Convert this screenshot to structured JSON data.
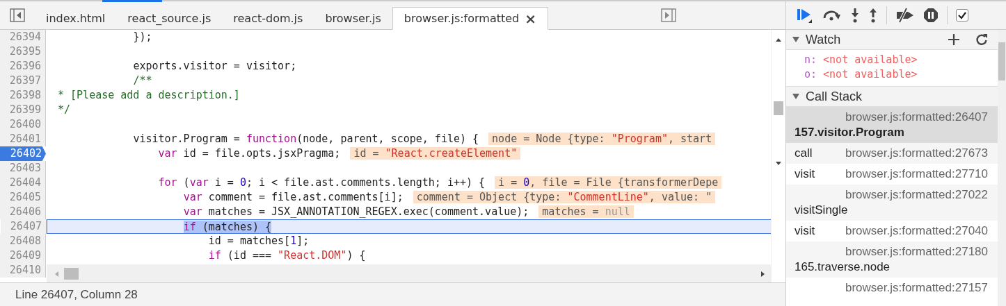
{
  "editor_tabs": [
    {
      "label": "index.html",
      "selected": false,
      "closable": false
    },
    {
      "label": "react_source.js",
      "selected": false,
      "closable": false
    },
    {
      "label": "react-dom.js",
      "selected": false,
      "closable": false
    },
    {
      "label": "browser.js",
      "selected": false,
      "closable": false
    },
    {
      "label": "browser.js:formatted",
      "selected": true,
      "closable": true,
      "close_glyph": "×"
    }
  ],
  "code_lines": [
    {
      "number": "26394",
      "breakpoint": false,
      "current": false,
      "tokens": [
        {
          "kind": "plain",
          "text": "            });"
        }
      ]
    },
    {
      "number": "26395",
      "breakpoint": false,
      "current": false
    },
    {
      "number": "26396",
      "breakpoint": false,
      "current": false,
      "tokens": [
        {
          "kind": "plain",
          "text": "            exports.visitor = visitor;"
        }
      ]
    },
    {
      "number": "26397",
      "breakpoint": false,
      "current": false,
      "tokens": [
        {
          "kind": "comment",
          "text": "            /**"
        }
      ]
    },
    {
      "number": "26398",
      "breakpoint": false,
      "current": false,
      "tokens": [
        {
          "kind": "comment",
          "text": "* [Please add a description.]"
        }
      ]
    },
    {
      "number": "26399",
      "breakpoint": false,
      "current": false,
      "tokens": [
        {
          "kind": "comment",
          "text": "*/"
        }
      ]
    },
    {
      "number": "26400",
      "breakpoint": false,
      "current": false
    },
    {
      "number": "26401",
      "breakpoint": false,
      "current": false,
      "tokens": [
        {
          "kind": "plain",
          "text": "            visitor.Program = "
        },
        {
          "kind": "keyword",
          "text": "function"
        },
        {
          "kind": "plain",
          "text": "(node, parent, scope, file) {"
        }
      ],
      "inline_value": [
        {
          "kind": "plain",
          "text": "node = Node {type: "
        },
        {
          "kind": "string",
          "text": "\"Program\""
        },
        {
          "kind": "plain",
          "text": ", start"
        }
      ]
    },
    {
      "number": "26402",
      "breakpoint": true,
      "current": false,
      "tokens": [
        {
          "kind": "keyword",
          "text": "                var"
        },
        {
          "kind": "plain",
          "text": " id = file.opts.jsxPragma;"
        }
      ],
      "inline_value": [
        {
          "kind": "plain",
          "text": "id = "
        },
        {
          "kind": "string",
          "text": "\"React.createElement\""
        }
      ]
    },
    {
      "number": "26403",
      "breakpoint": false,
      "current": false
    },
    {
      "number": "26404",
      "breakpoint": false,
      "current": false,
      "tokens": [
        {
          "kind": "keyword",
          "text": "                for"
        },
        {
          "kind": "plain",
          "text": " ("
        },
        {
          "kind": "keyword",
          "text": "var"
        },
        {
          "kind": "plain",
          "text": " i = "
        },
        {
          "kind": "number",
          "text": "0"
        },
        {
          "kind": "plain",
          "text": "; i < file.ast.comments.length; i++) {"
        }
      ],
      "inline_value": [
        {
          "kind": "plain",
          "text": "i = "
        },
        {
          "kind": "number",
          "text": "0"
        },
        {
          "kind": "plain",
          "text": ", file = File {transformerDepe"
        }
      ]
    },
    {
      "number": "26405",
      "breakpoint": false,
      "current": false,
      "tokens": [
        {
          "kind": "keyword",
          "text": "                    var"
        },
        {
          "kind": "plain",
          "text": " comment = file.ast.comments[i];"
        }
      ],
      "inline_value": [
        {
          "kind": "plain",
          "text": "comment = Object {type: "
        },
        {
          "kind": "string",
          "text": "\"CommentLine\""
        },
        {
          "kind": "plain",
          "text": ", value: \""
        }
      ]
    },
    {
      "number": "26406",
      "breakpoint": false,
      "current": false,
      "tokens": [
        {
          "kind": "keyword",
          "text": "                    var"
        },
        {
          "kind": "plain",
          "text": " matches = JSX_ANNOTATION_REGEX.exec(comment.value);"
        }
      ],
      "inline_value": [
        {
          "kind": "plain",
          "text": "matches = "
        },
        {
          "kind": "null",
          "text": "null"
        }
      ]
    },
    {
      "number": "26407",
      "breakpoint": false,
      "current": true,
      "tokens": [
        {
          "kind": "keyword",
          "text": "                    if"
        },
        {
          "kind": "plain",
          "text": " (matches) {"
        }
      ]
    },
    {
      "number": "26408",
      "breakpoint": false,
      "current": false,
      "tokens": [
        {
          "kind": "plain",
          "text": "                        id = matches["
        },
        {
          "kind": "number",
          "text": "1"
        },
        {
          "kind": "plain",
          "text": "];"
        }
      ]
    },
    {
      "number": "26409",
      "breakpoint": false,
      "current": false,
      "tokens": [
        {
          "kind": "keyword",
          "text": "                        if"
        },
        {
          "kind": "plain",
          "text": " (id === "
        },
        {
          "kind": "string",
          "text": "\"React.DOM\""
        },
        {
          "kind": "plain",
          "text": ") {"
        }
      ]
    },
    {
      "number": "26410",
      "breakpoint": false,
      "current": false
    }
  ],
  "status_bar": {
    "text": "Line 26407, Column 28"
  },
  "debugger_toolbar": [
    {
      "kind": "resume"
    },
    {
      "kind": "step-over"
    },
    {
      "kind": "step-into"
    },
    {
      "kind": "step-out"
    },
    {
      "kind": "divider"
    },
    {
      "kind": "deactivate"
    },
    {
      "kind": "pause-exceptions"
    },
    {
      "kind": "divider"
    },
    {
      "kind": "checkbox",
      "checked": true
    }
  ],
  "watch": {
    "title": "Watch",
    "expanded": true,
    "items": [
      {
        "name": "n:",
        "value": "<not available>"
      },
      {
        "name": "o:",
        "value": "<not available>"
      }
    ]
  },
  "call_stack": {
    "title": "Call Stack",
    "expanded": true,
    "frames": [
      {
        "function": "157.visitor.Program",
        "location": "browser.js:formatted:26407",
        "selected": true
      },
      {
        "function": "call",
        "location": "browser.js:formatted:27673",
        "selected": false
      },
      {
        "function": "visit",
        "location": "browser.js:formatted:27710",
        "selected": false
      },
      {
        "function": "visitSingle",
        "location": "browser.js:formatted:27022",
        "selected": false
      },
      {
        "function": "visit",
        "location": "browser.js:formatted:27040",
        "selected": false
      },
      {
        "function": "165.traverse.node",
        "location": "browser.js:formatted:27180",
        "selected": false
      },
      {
        "location": "browser.js:formatted:27157",
        "selected": false
      }
    ]
  }
}
